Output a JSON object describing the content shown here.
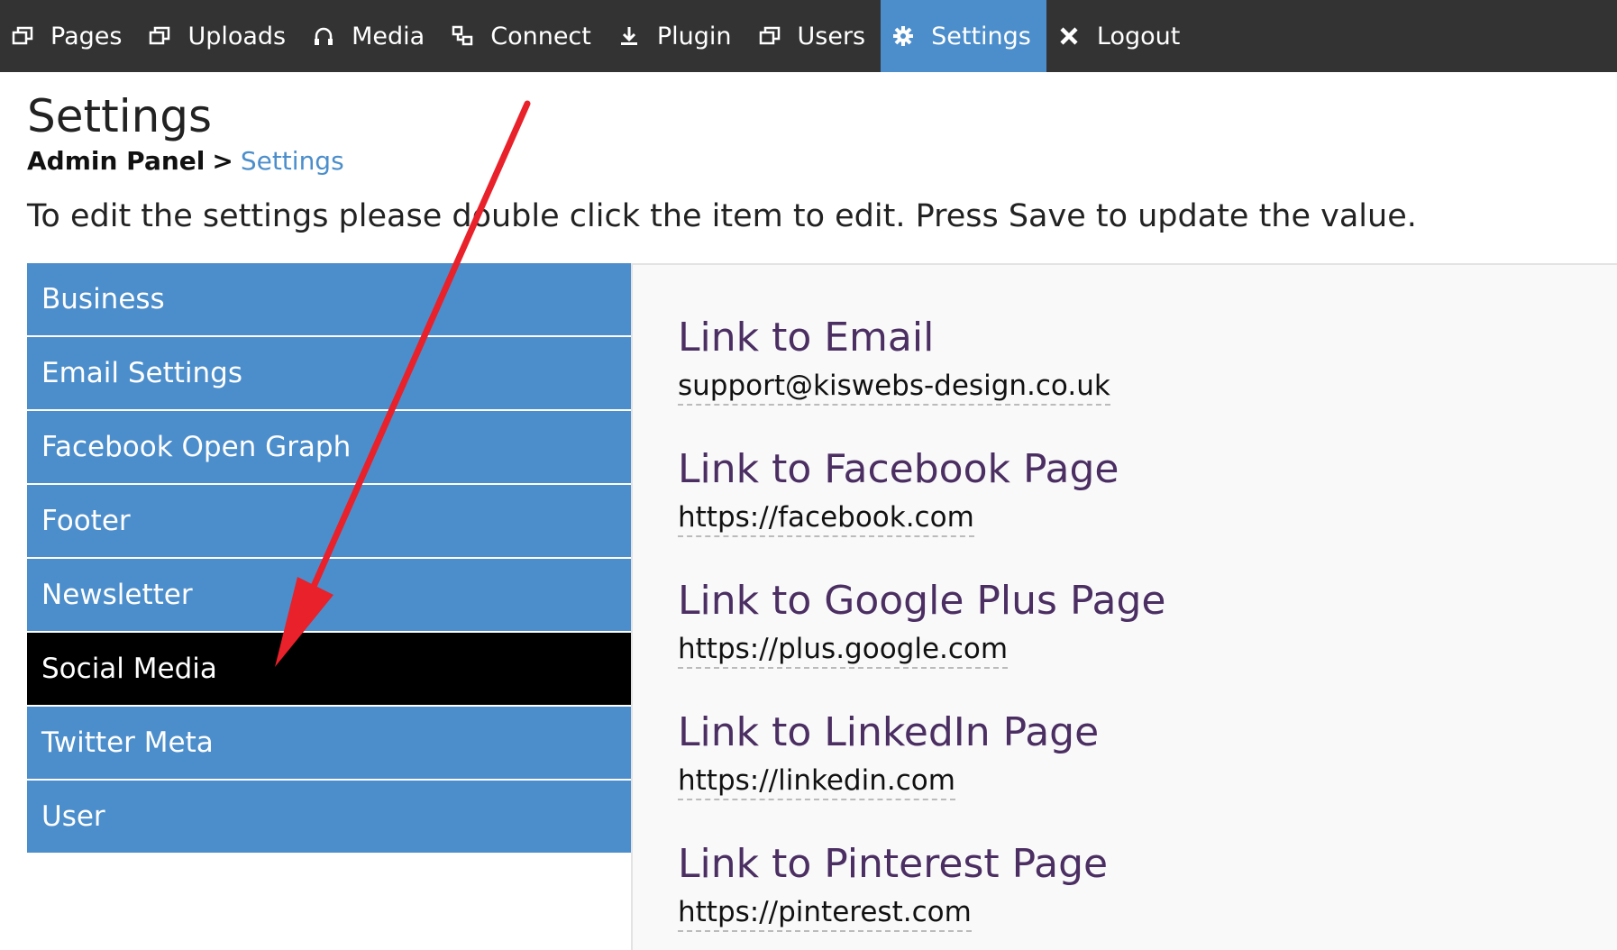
{
  "nav": {
    "items": [
      {
        "label": "Pages",
        "icon": "window-icon"
      },
      {
        "label": "Uploads",
        "icon": "window-icon"
      },
      {
        "label": "Media",
        "icon": "headphones-icon"
      },
      {
        "label": "Connect",
        "icon": "connect-icon"
      },
      {
        "label": "Plugin",
        "icon": "download-icon"
      },
      {
        "label": "Users",
        "icon": "window-icon"
      },
      {
        "label": "Settings",
        "icon": "gear-icon"
      },
      {
        "label": "Logout",
        "icon": "close-icon"
      }
    ],
    "active": "Settings"
  },
  "header": {
    "title": "Settings",
    "breadcrumb_root": "Admin Panel",
    "breadcrumb_sep": ">",
    "breadcrumb_current": "Settings",
    "instructions": "To edit the settings please double click the item to edit. Press Save to update the value."
  },
  "sidebar": {
    "items": [
      {
        "label": "Business"
      },
      {
        "label": "Email Settings"
      },
      {
        "label": "Facebook Open Graph"
      },
      {
        "label": "Footer"
      },
      {
        "label": "Newsletter"
      },
      {
        "label": "Social Media"
      },
      {
        "label": "Twitter Meta"
      },
      {
        "label": "User"
      }
    ],
    "active": "Social Media"
  },
  "settings": [
    {
      "label": "Link to Email",
      "value": "support@kiswebs-design.co.uk"
    },
    {
      "label": "Link to Facebook Page",
      "value": "https://facebook.com"
    },
    {
      "label": "Link to Google Plus Page",
      "value": "https://plus.google.com"
    },
    {
      "label": "Link to LinkedIn Page",
      "value": "https://linkedin.com"
    },
    {
      "label": "Link to Pinterest Page",
      "value": "https://pinterest.com"
    }
  ],
  "colors": {
    "topbar": "#333333",
    "accent": "#4c8ecb",
    "active_menu": "#000000",
    "setting_label": "#4b2e62",
    "annotation": "#e8212a"
  }
}
